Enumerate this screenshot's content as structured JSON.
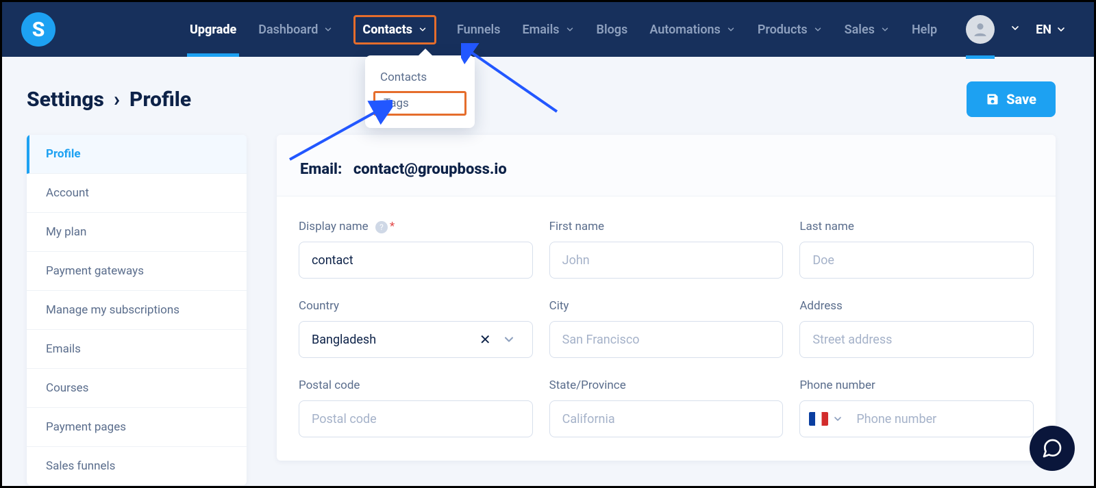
{
  "brand": {
    "logo_letter": "S"
  },
  "nav": {
    "upgrade": "Upgrade",
    "dashboard": "Dashboard",
    "contacts": "Contacts",
    "funnels": "Funnels",
    "emails": "Emails",
    "blogs": "Blogs",
    "automations": "Automations",
    "products": "Products",
    "sales": "Sales",
    "help": "Help",
    "lang": "EN"
  },
  "dropdown": {
    "contacts": "Contacts",
    "tags": "Tags"
  },
  "breadcrumb": {
    "settings": "Settings",
    "profile": "Profile"
  },
  "save_button": "Save",
  "sidebar": {
    "items": [
      "Profile",
      "Account",
      "My plan",
      "Payment gateways",
      "Manage my subscriptions",
      "Emails",
      "Courses",
      "Payment pages",
      "Sales funnels"
    ]
  },
  "email_line": {
    "label": "Email:",
    "value": "contact@groupboss.io"
  },
  "form": {
    "display_name": {
      "label": "Display name",
      "value": "contact"
    },
    "first_name": {
      "label": "First name",
      "placeholder": "John"
    },
    "last_name": {
      "label": "Last name",
      "placeholder": "Doe"
    },
    "country": {
      "label": "Country",
      "value": "Bangladesh"
    },
    "city": {
      "label": "City",
      "placeholder": "San Francisco"
    },
    "address": {
      "label": "Address",
      "placeholder": "Street address"
    },
    "postal_code": {
      "label": "Postal code",
      "placeholder": "Postal code"
    },
    "state": {
      "label": "State/Province",
      "placeholder": "California"
    },
    "phone": {
      "label": "Phone number",
      "placeholder": "Phone number"
    }
  }
}
